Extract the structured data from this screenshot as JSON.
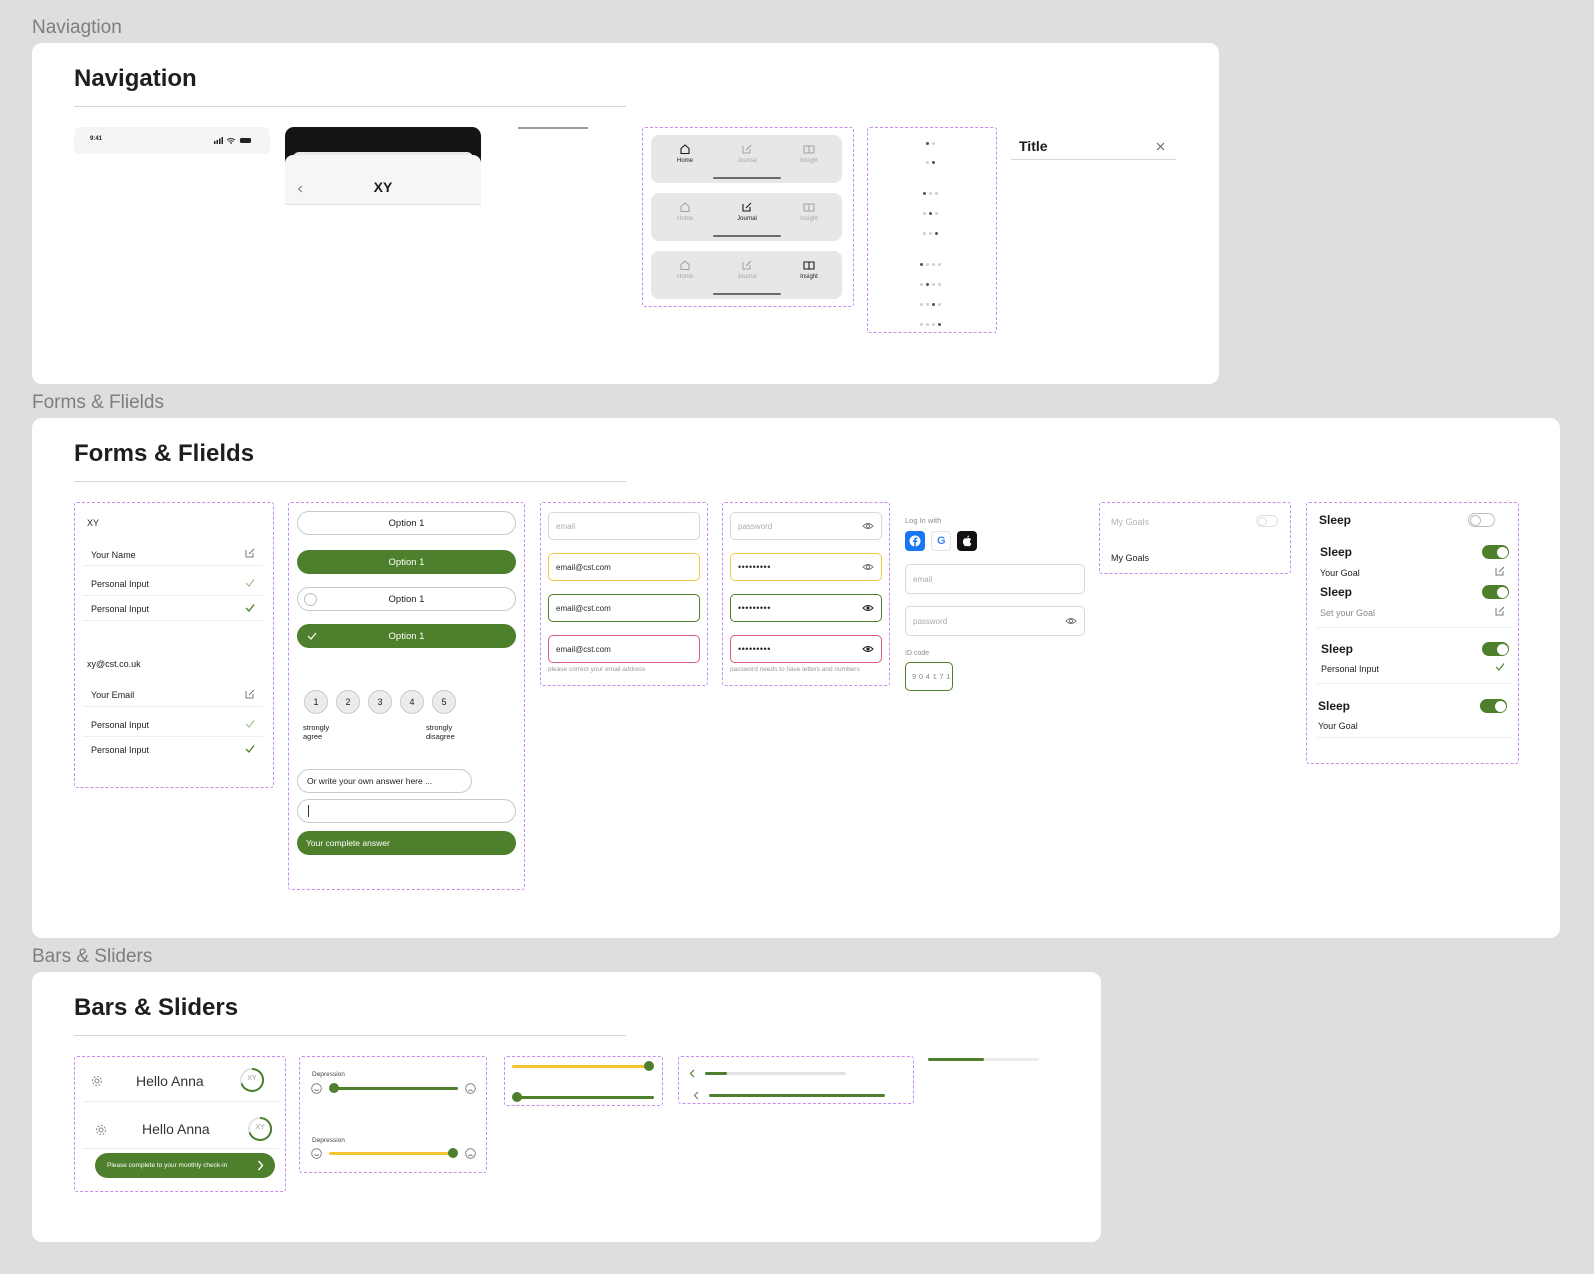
{
  "sections": {
    "navigation": {
      "label": "Naviagtion",
      "title": "Navigation"
    },
    "forms": {
      "label": "Forms & Flields",
      "title": "Forms & Flields"
    },
    "bars": {
      "label": "Bars & Sliders",
      "title": "Bars & Sliders"
    }
  },
  "status_bar": {
    "time": "9:41"
  },
  "header_card": {
    "title": "XY"
  },
  "tab_bar": {
    "tabs": [
      {
        "label": "Home",
        "icon": "home-icon"
      },
      {
        "label": "Journal",
        "icon": "edit-icon"
      },
      {
        "label": "Insight",
        "icon": "book-icon"
      }
    ],
    "active_indices": [
      0,
      1,
      2
    ]
  },
  "page_dots": {
    "groups": [
      [
        0,
        1
      ],
      [
        0,
        1,
        2
      ],
      [
        0,
        1,
        2,
        3
      ]
    ]
  },
  "title_bar": {
    "title": "Title",
    "close_icon": "close-icon"
  },
  "profile_list": {
    "group1_title": "XY",
    "group1": [
      {
        "label": "Your Name",
        "icon": "edit-icon"
      },
      {
        "label": "Personal Input",
        "icon": "check-icon",
        "state": "light"
      },
      {
        "label": "Personal Input",
        "icon": "check-icon",
        "state": "green"
      }
    ],
    "group2_title": "xy@cst.co.uk",
    "group2": [
      {
        "label": "Your Email",
        "icon": "edit-icon"
      },
      {
        "label": "Personal Input",
        "icon": "check-icon",
        "state": "light"
      },
      {
        "label": "Personal Input",
        "icon": "check-icon",
        "state": "green"
      }
    ]
  },
  "options": {
    "option_label": "Option 1",
    "scale": [
      "1",
      "2",
      "3",
      "4",
      "5"
    ],
    "scale_left": "strongly\nagree",
    "scale_right": "strongly\ndisagree",
    "write_own": "Or write your own answer here ...",
    "complete": "Your complete answer"
  },
  "email_fields": {
    "placeholder": "email",
    "value": "email@cst.com",
    "error": "please correct your email address"
  },
  "password_fields": {
    "placeholder": "password",
    "value": "•••••••••",
    "error": "password needs to have letters and numbers"
  },
  "login": {
    "title": "Log In with",
    "email_placeholder": "email",
    "password_placeholder": "password",
    "id_label": "ID code",
    "id_value": "9 0 4 1 7 1"
  },
  "goals": {
    "label1": "My Goals",
    "label2": "My Goals"
  },
  "sleep": {
    "title": "Sleep",
    "rows": [
      {
        "sub": "Your Goal",
        "icon": "edit-icon"
      },
      {
        "sub": "Set your Goal",
        "icon": "edit-icon"
      },
      {
        "sub": "Personal Input",
        "icon": "check-icon"
      },
      {
        "sub": "Your Goal",
        "icon": ""
      }
    ]
  },
  "greeting": {
    "hello": "Hello Anna",
    "avatar": "XY",
    "checkin": "Please complete to your monthly check-in"
  },
  "depression_sliders": {
    "label": "Depression",
    "values": [
      0.0,
      1.0
    ]
  },
  "colors": {
    "green": "#4e7f2c",
    "yellow": "#f4c430",
    "purple_dash": "#c78bf0"
  }
}
